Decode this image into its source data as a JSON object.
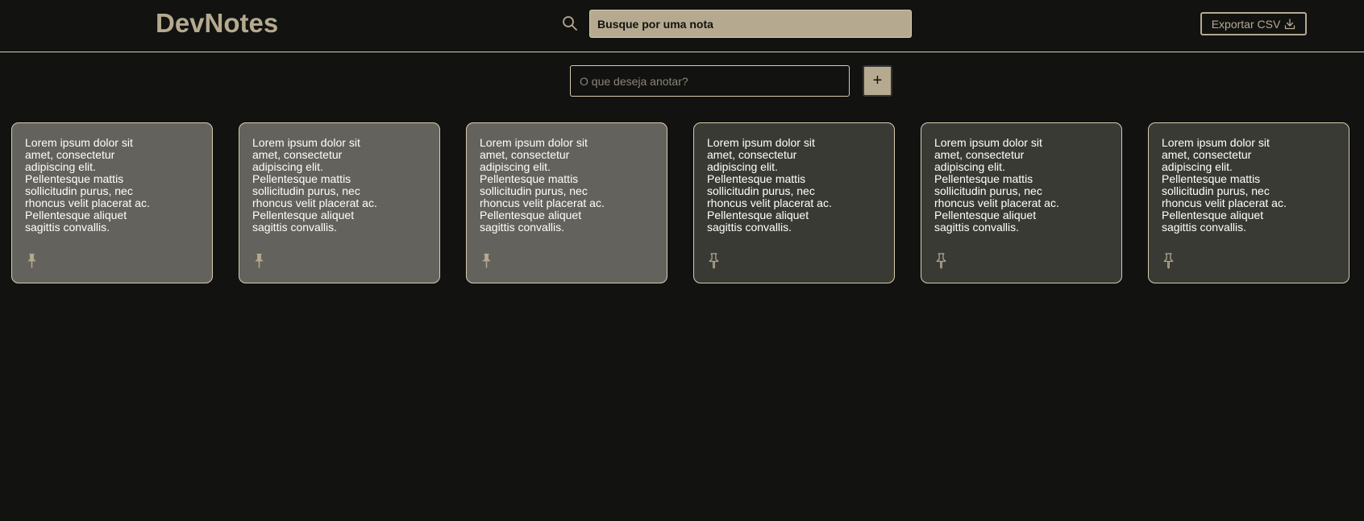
{
  "app": {
    "title": "DevNotes"
  },
  "search": {
    "placeholder": "Busque por uma nota",
    "icon": "search-icon"
  },
  "toolbar": {
    "export_label": "Exportar CSV",
    "export_icon": "download-icon"
  },
  "composer": {
    "placeholder": "O que deseja anotar?",
    "add_label": "+"
  },
  "colors": {
    "background": "#121211",
    "accent": "#b5aa8f",
    "border": "#d8ccb0",
    "pinned_card": "#64625c",
    "unpinned_card": "#3a3a34"
  },
  "notes": [
    {
      "text": "Lorem ipsum dolor sit amet, consectetur adipiscing elit. Pellentesque mattis sollicitudin purus, nec rhoncus velit placerat ac. Pellentesque aliquet sagittis convallis.",
      "pinned": true
    },
    {
      "text": "Lorem ipsum dolor sit amet, consectetur adipiscing elit. Pellentesque mattis sollicitudin purus, nec rhoncus velit placerat ac. Pellentesque aliquet sagittis convallis.",
      "pinned": true
    },
    {
      "text": "Lorem ipsum dolor sit amet, consectetur adipiscing elit. Pellentesque mattis sollicitudin purus, nec rhoncus velit placerat ac. Pellentesque aliquet sagittis convallis.",
      "pinned": true
    },
    {
      "text": "Lorem ipsum dolor sit amet, consectetur adipiscing elit. Pellentesque mattis sollicitudin purus, nec rhoncus velit placerat ac. Pellentesque aliquet sagittis convallis.",
      "pinned": false
    },
    {
      "text": "Lorem ipsum dolor sit amet, consectetur adipiscing elit. Pellentesque mattis sollicitudin purus, nec rhoncus velit placerat ac. Pellentesque aliquet sagittis convallis.",
      "pinned": false
    },
    {
      "text": "Lorem ipsum dolor sit amet, consectetur adipiscing elit. Pellentesque mattis sollicitudin purus, nec rhoncus velit placerat ac. Pellentesque aliquet sagittis convallis.",
      "pinned": false
    }
  ]
}
